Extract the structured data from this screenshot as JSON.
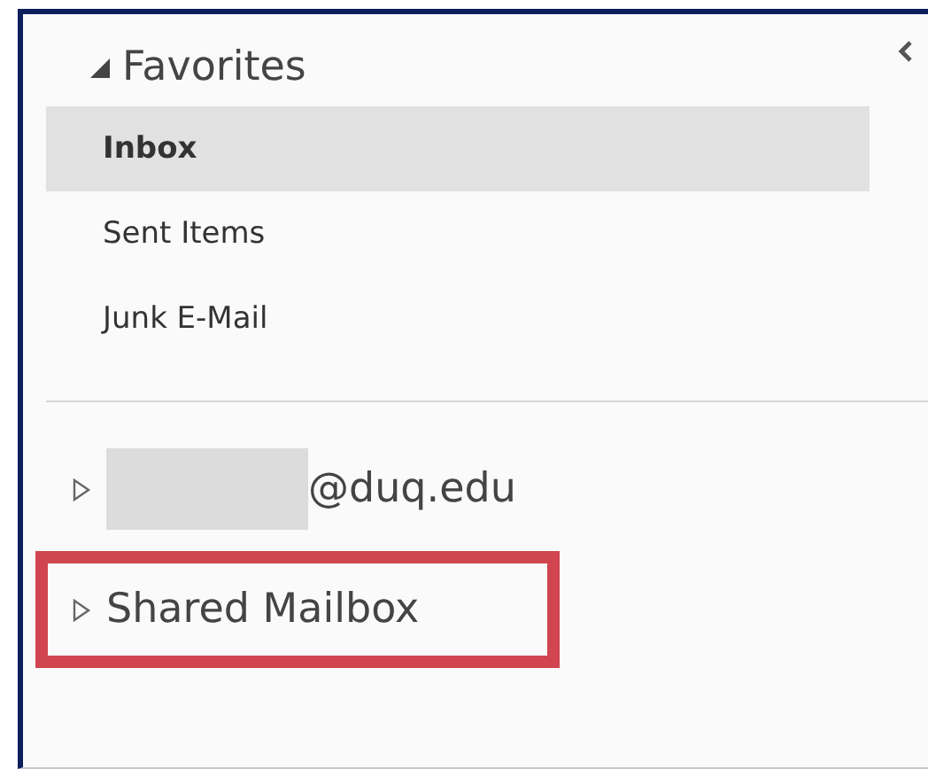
{
  "favorites": {
    "title": "Favorites",
    "expanded": true,
    "items": [
      {
        "label": "Inbox",
        "selected": true
      },
      {
        "label": "Sent Items",
        "selected": false
      },
      {
        "label": "Junk E-Mail",
        "selected": false
      }
    ]
  },
  "accounts": [
    {
      "label": "@duq.edu",
      "expanded": false,
      "redacted": true,
      "highlighted": false
    },
    {
      "label": "Shared Mailbox",
      "expanded": false,
      "redacted": false,
      "highlighted": true
    }
  ]
}
